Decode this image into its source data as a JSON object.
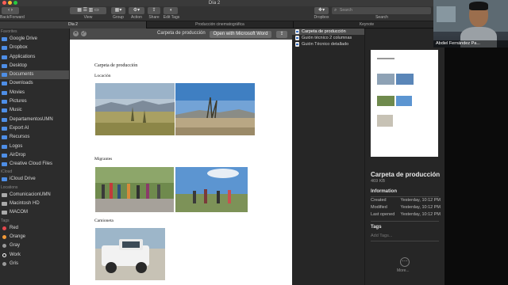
{
  "window": {
    "title": "Día 2"
  },
  "toolbar": {
    "back_label": "Back/Forward",
    "view_label": "View",
    "group_label": "Group",
    "action_label": "Action",
    "share_label": "Share",
    "edit_tags_label": "Edit Tags",
    "dropbox_label": "Dropbox",
    "search_label": "Search",
    "search_placeholder": "Search"
  },
  "tabs": [
    {
      "label": "Día 2"
    },
    {
      "label": "Producción cinematográfica"
    },
    {
      "label": "Keynote"
    }
  ],
  "sidebar": {
    "favorites_header": "Favorites",
    "favorites": [
      {
        "label": "Google Drive"
      },
      {
        "label": "Dropbox"
      },
      {
        "label": "Applications"
      },
      {
        "label": "Desktop"
      },
      {
        "label": "Documents",
        "selected": true
      },
      {
        "label": "Downloads"
      },
      {
        "label": "Movies"
      },
      {
        "label": "Pictures"
      },
      {
        "label": "Music"
      },
      {
        "label": "DepartamentosUMN"
      },
      {
        "label": "Export AI"
      },
      {
        "label": "Recursos"
      },
      {
        "label": "Logos"
      },
      {
        "label": "AirDrop"
      },
      {
        "label": "Creative Cloud Files"
      }
    ],
    "icloud_header": "iCloud",
    "icloud": [
      {
        "label": "iCloud Drive"
      }
    ],
    "locations_header": "Locations",
    "locations": [
      {
        "label": "ComunicacionUMN"
      },
      {
        "label": "Macintosh HD"
      },
      {
        "label": "MACOM"
      }
    ],
    "tags_header": "Tags",
    "tags": [
      {
        "label": "Red",
        "color": "#e5484d"
      },
      {
        "label": "Orange",
        "color": "#f29a38"
      },
      {
        "label": "Gray",
        "color": "#9a9a9a"
      },
      {
        "label": "Work",
        "color": "#ffffff"
      },
      {
        "label": "Gris",
        "color": "#9a9a9a"
      }
    ]
  },
  "quicklook": {
    "title": "Carpeta de producción",
    "open_button": "Open with Microsoft Word",
    "document": {
      "title": "Carpeta de producción",
      "section1": "Locación",
      "section2": "Migrantes",
      "section3": "Camioneta"
    }
  },
  "file_list": [
    {
      "name": "Carpeta de producción",
      "selected": true
    },
    {
      "name": "Guión técnico 2 columnas"
    },
    {
      "name": "Guión Técnico detallado"
    }
  ],
  "info": {
    "name": "Carpeta de producción",
    "size": "469 KB",
    "information_header": "Information",
    "rows": [
      {
        "label": "Created",
        "value": "Yesterday, 10:12 PM"
      },
      {
        "label": "Modified",
        "value": "Yesterday, 10:12 PM"
      },
      {
        "label": "Last opened",
        "value": "Yesterday, 10:12 PM"
      }
    ],
    "tags_header": "Tags",
    "tags_placeholder": "Add Tags...",
    "more_label": "More..."
  },
  "video": {
    "participant_name": "Abdiel Fernández Pa..."
  },
  "colors": {
    "accent": "#4e8ee6",
    "selection": "#4d4d4d"
  }
}
